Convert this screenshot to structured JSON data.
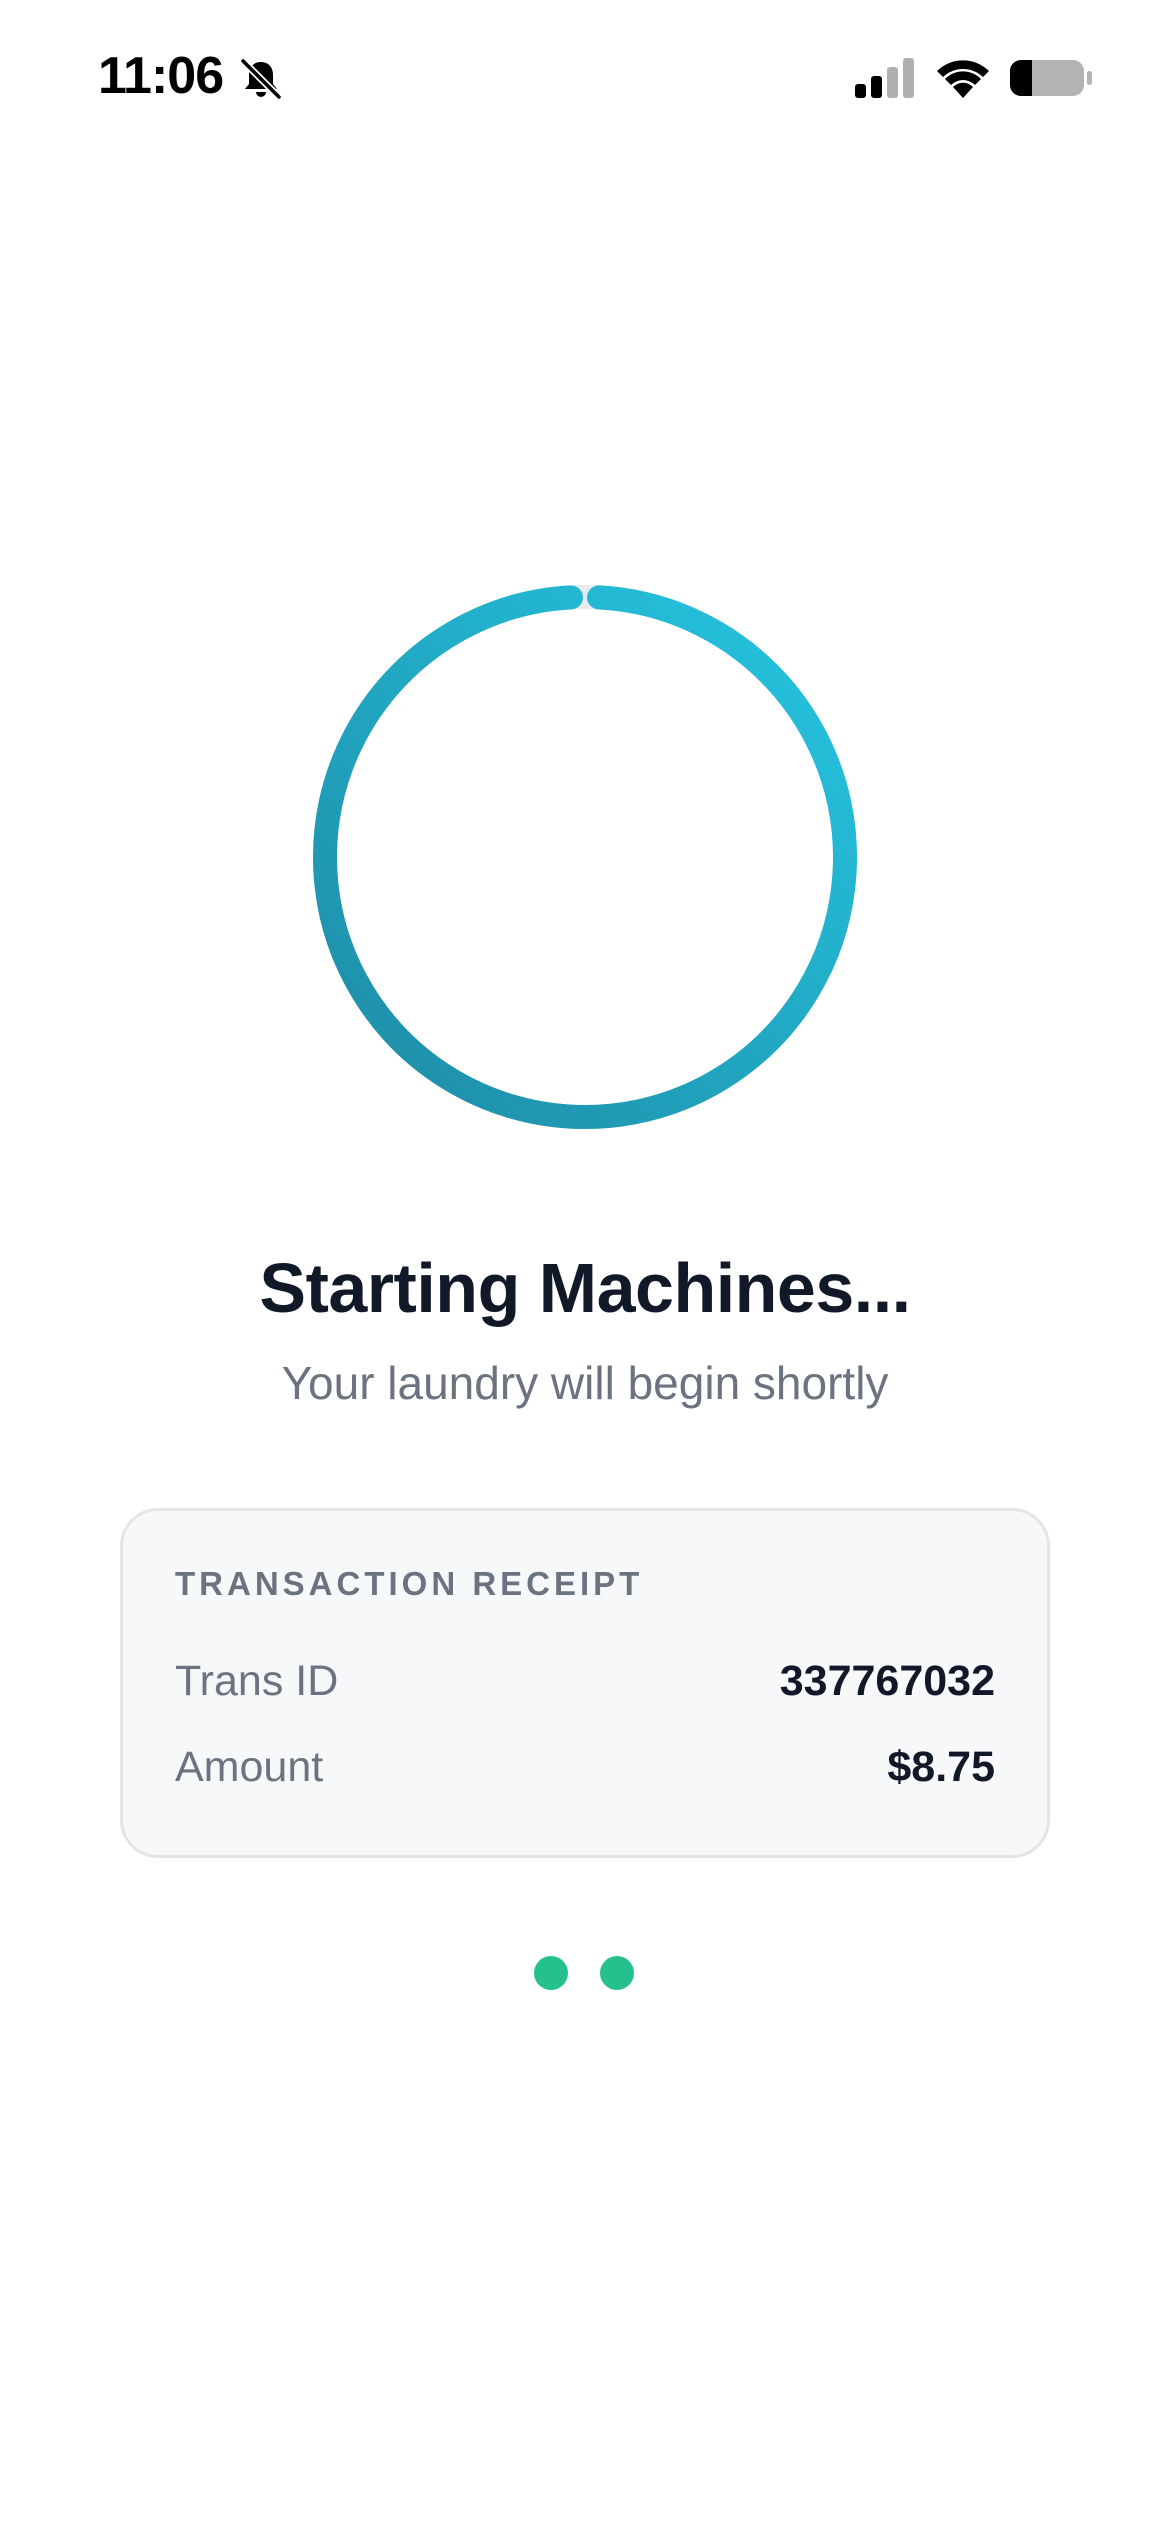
{
  "status_bar": {
    "time": "11:06",
    "icons": [
      "bell-muted-icon",
      "cellular-signal-icon",
      "wifi-icon",
      "battery-icon"
    ]
  },
  "spinner": {
    "icon": "loading-ring-icon",
    "colors": {
      "start": "#1e8aa4",
      "end": "#25c6e2"
    }
  },
  "main": {
    "title": "Starting Machines...",
    "subtitle": "Your laundry will begin shortly"
  },
  "receipt": {
    "heading": "TRANSACTION RECEIPT",
    "rows": [
      {
        "label": "Trans ID",
        "value": "337767032"
      },
      {
        "label": "Amount",
        "value": "$8.75"
      }
    ]
  },
  "loader_dots": {
    "count": 2,
    "color": "#26c08e"
  },
  "colors": {
    "title": "#111827",
    "muted_text": "#6b7280",
    "card_bg": "#f7f8fa",
    "card_border": "#e3e5e8"
  }
}
